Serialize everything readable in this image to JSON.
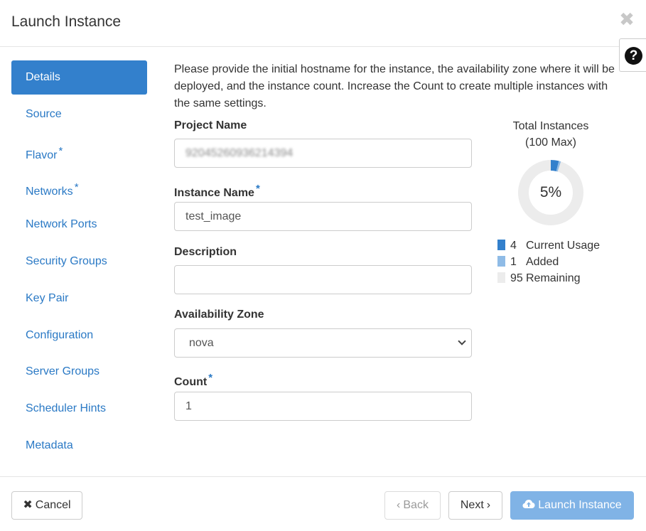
{
  "modal": {
    "title": "Launch Instance",
    "close_glyph": "✖",
    "help_glyph": "?"
  },
  "nav": {
    "items": [
      {
        "label": "Details",
        "active": true,
        "required": false
      },
      {
        "label": "Source",
        "active": false,
        "required": false
      },
      {
        "label": "Flavor",
        "active": false,
        "required": true
      },
      {
        "label": "Networks",
        "active": false,
        "required": true
      },
      {
        "label": "Network Ports",
        "active": false,
        "required": false
      },
      {
        "label": "Security Groups",
        "active": false,
        "required": false
      },
      {
        "label": "Key Pair",
        "active": false,
        "required": false
      },
      {
        "label": "Configuration",
        "active": false,
        "required": false
      },
      {
        "label": "Server Groups",
        "active": false,
        "required": false
      },
      {
        "label": "Scheduler Hints",
        "active": false,
        "required": false
      },
      {
        "label": "Metadata",
        "active": false,
        "required": false
      }
    ],
    "required_mark": "*"
  },
  "details": {
    "intro": "Please provide the initial hostname for the instance, the availability zone where it will be deployed, and the instance count. Increase the Count to create multiple instances with the same settings.",
    "project_name": {
      "label": "Project Name",
      "value": "92045260936214394"
    },
    "instance_name": {
      "label": "Instance Name",
      "value": "test_image",
      "required_mark": "*"
    },
    "description": {
      "label": "Description",
      "value": ""
    },
    "availability_zone": {
      "label": "Availability Zone",
      "value": "nova"
    },
    "count": {
      "label": "Count",
      "value": "1",
      "required_mark": "*"
    }
  },
  "usage": {
    "title_line1": "Total Instances",
    "title_line2": "(100 Max)",
    "percent_label": "5%",
    "max": 100,
    "current": 4,
    "added": 1,
    "remaining": 95,
    "legend": [
      {
        "num": "4",
        "label": "Current Usage",
        "color": "#3380cc"
      },
      {
        "num": "1",
        "label": "Added",
        "color": "#8fbbe6"
      },
      {
        "num": "95",
        "label": "Remaining",
        "color": "#ececec"
      }
    ]
  },
  "footer": {
    "cancel_label": "Cancel",
    "cancel_icon": "✖",
    "back_label": "Back",
    "back_icon": "‹",
    "next_label": "Next",
    "next_icon": "›",
    "launch_label": "Launch Instance",
    "launch_icon": "cloud-upload-icon"
  },
  "colors": {
    "primary": "#3380cc",
    "link": "#2a79c5",
    "launch_disabled": "#80b3e6"
  }
}
